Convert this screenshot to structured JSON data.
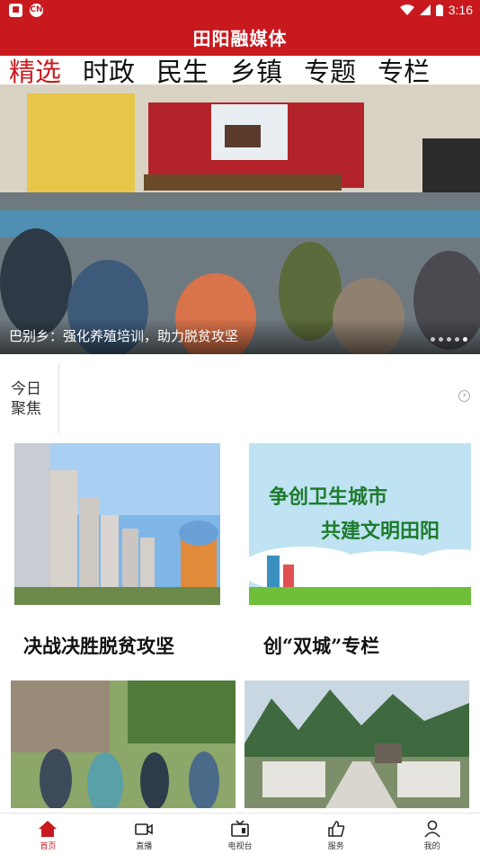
{
  "status_bar": {
    "time": "3:16",
    "left_badge": "CN"
  },
  "app": {
    "title": "田阳融媒体"
  },
  "tabs": [
    {
      "label": "精选",
      "active": true
    },
    {
      "label": "时政",
      "active": false
    },
    {
      "label": "民生",
      "active": false
    },
    {
      "label": "乡镇",
      "active": false
    },
    {
      "label": "专题",
      "active": false
    },
    {
      "label": "专栏",
      "active": false
    }
  ],
  "hero": {
    "caption": "巴别乡：强化养殖培训，助力脱贫攻坚",
    "slides": 5,
    "active_slide": 5
  },
  "today_focus": {
    "label_line1": "今日",
    "label_line2": "聚焦"
  },
  "cards": [
    {
      "title": "决战决胜脱贫攻坚"
    },
    {
      "title": "创“双城”专栏",
      "banner_line1": "争创卫生城市",
      "banner_line2": "共建文明田阳"
    }
  ],
  "nav": [
    {
      "label": "首页",
      "icon": "home-icon",
      "active": true
    },
    {
      "label": "直播",
      "icon": "video-camera-icon",
      "active": false
    },
    {
      "label": "电视台",
      "icon": "tv-icon",
      "active": false
    },
    {
      "label": "服务",
      "icon": "thumbs-up-icon",
      "active": false
    },
    {
      "label": "我的",
      "icon": "person-icon",
      "active": false
    }
  ],
  "colors": {
    "brand_red": "#c8191f"
  }
}
